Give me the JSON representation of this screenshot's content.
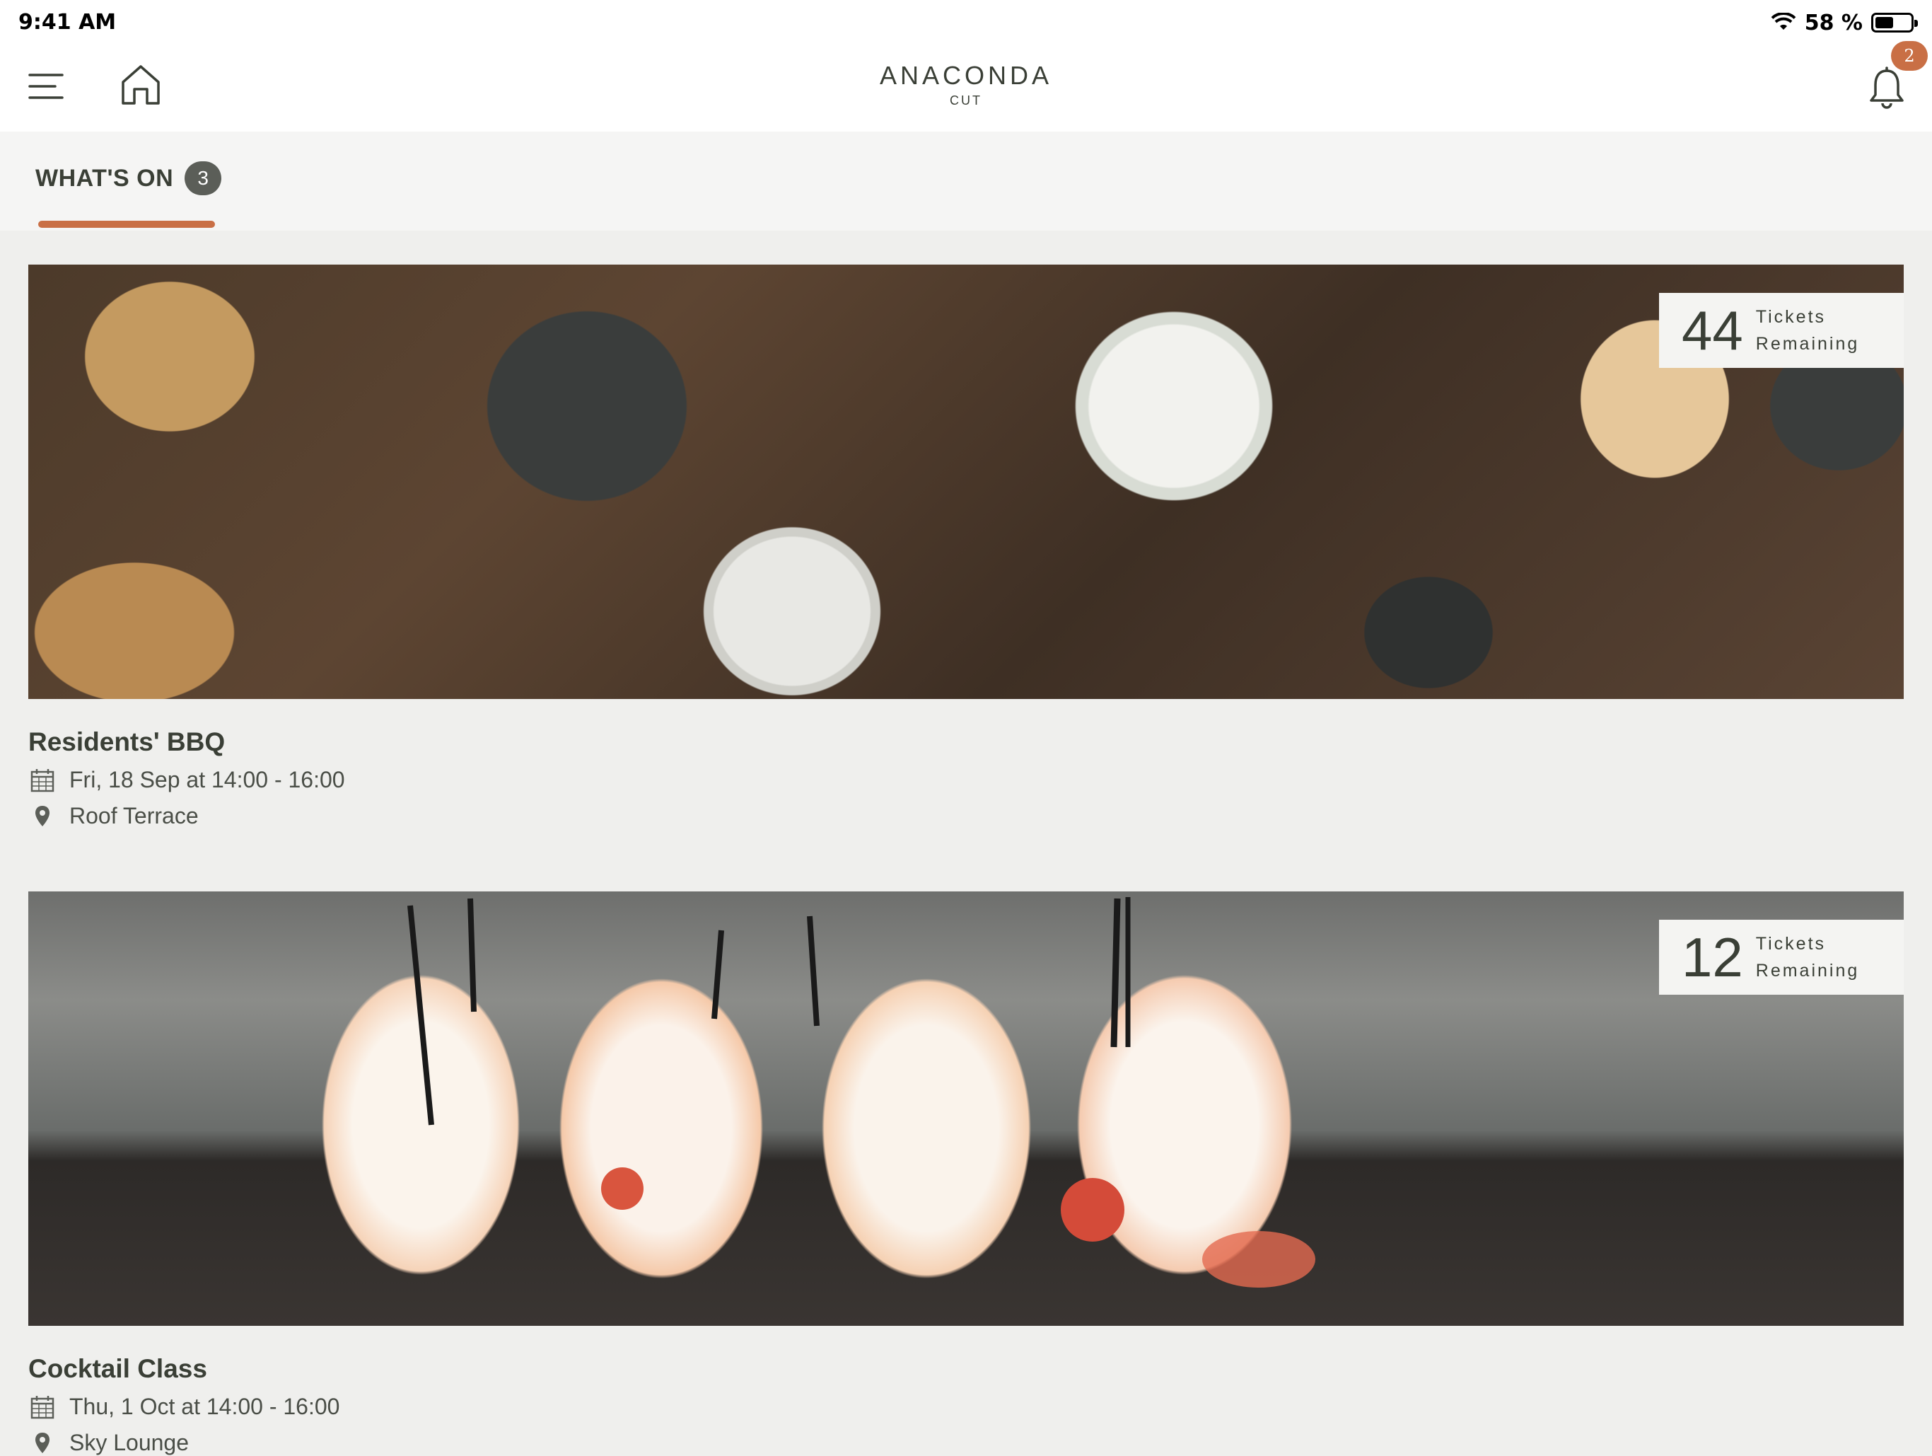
{
  "status_bar": {
    "time": "9:41 AM",
    "battery_percent": "58 %",
    "battery_level": 0.58
  },
  "header": {
    "brand_name": "ANACONDA",
    "brand_sub": "CUT",
    "notification_count": "2",
    "icons": [
      "menu-icon",
      "home-icon",
      "bell-icon"
    ]
  },
  "tabs": [
    {
      "label": "WHAT'S ON",
      "count": "3",
      "active": true
    }
  ],
  "colors": {
    "accent": "#c96f45",
    "text": "#3a3f36",
    "background": "#efefed"
  },
  "events": [
    {
      "title": "Residents' BBQ",
      "date": "Fri, 18 Sep at 14:00 - 16:00",
      "location": "Roof Terrace",
      "tickets_count": "44",
      "tickets_label_1": "Tickets",
      "tickets_label_2": "Remaining"
    },
    {
      "title": "Cocktail Class",
      "date": "Thu, 1 Oct at 14:00 - 16:00",
      "location": "Sky Lounge",
      "tickets_count": "12",
      "tickets_label_1": "Tickets",
      "tickets_label_2": "Remaining"
    }
  ]
}
